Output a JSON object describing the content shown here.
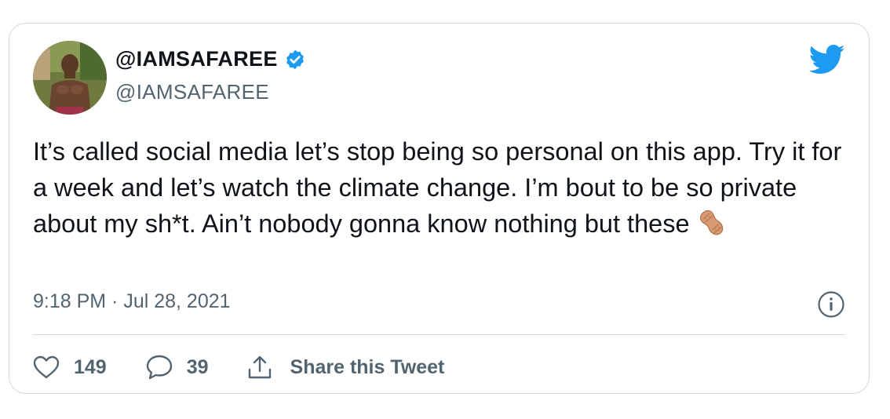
{
  "tweet": {
    "display_name": "@IAMSAFAREE",
    "handle": "@IAMSAFAREE",
    "text": "It’s called social media let’s stop being so personal on this app. Try it for a week and let’s watch the climate change. I’m bout to be so private about my sh*t. Ain’t nobody gonna know nothing but these",
    "emoji": "peanut",
    "timestamp": "9:18 PM · Jul 28, 2021",
    "likes": "149",
    "replies": "39",
    "share_label": "Share this Tweet"
  },
  "colors": {
    "brand": "#1d9bf0",
    "text": "#0f1419",
    "muted": "#536471",
    "border": "#cfd9de"
  },
  "icons": [
    "verified-badge-icon",
    "twitter-bird-icon",
    "peanut-emoji-icon",
    "info-icon",
    "heart-icon",
    "reply-icon",
    "share-icon"
  ]
}
